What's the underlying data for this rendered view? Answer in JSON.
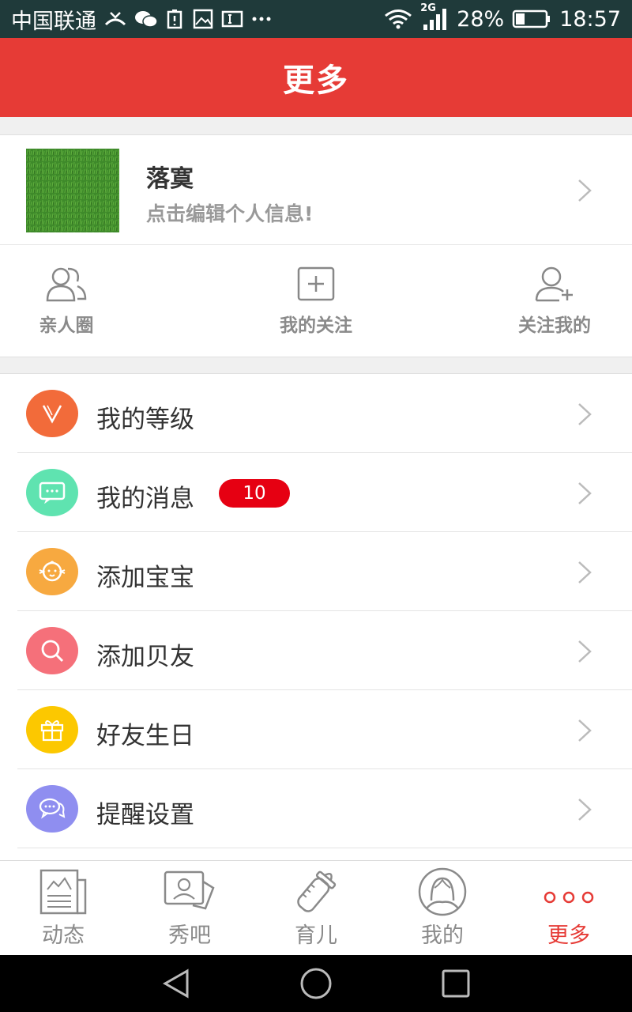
{
  "status_bar": {
    "carrier": "中国联通",
    "network": "2G",
    "battery": "28%",
    "time": "18:57",
    "icons": [
      "missed-call-icon",
      "wechat-icon",
      "battery-alert-icon",
      "image-icon",
      "sim-icon",
      "more-icon",
      "wifi-icon",
      "signal-icon",
      "battery-icon"
    ]
  },
  "header": {
    "title": "更多"
  },
  "profile": {
    "name": "落寞",
    "subtitle": "点击编辑个人信息!"
  },
  "shortcuts": [
    {
      "label": "亲人圈",
      "icon": "family-circle-icon"
    },
    {
      "label": "我的关注",
      "icon": "add-square-icon"
    },
    {
      "label": "关注我的",
      "icon": "add-user-icon"
    }
  ],
  "menu": [
    {
      "label": "我的等级",
      "icon": "level-v-icon",
      "color": "#f26b3a"
    },
    {
      "label": "我的消息",
      "icon": "message-icon",
      "color": "#5fe3b0",
      "badge": "10"
    },
    {
      "label": "添加宝宝",
      "icon": "baby-icon",
      "color": "#f7a940"
    },
    {
      "label": "添加贝友",
      "icon": "search-friend-icon",
      "color": "#f5707a"
    },
    {
      "label": "好友生日",
      "icon": "gift-icon",
      "color": "#fcc800"
    },
    {
      "label": "提醒设置",
      "icon": "chat-bubbles-icon",
      "color": "#8f8ef0"
    }
  ],
  "tabs": [
    {
      "label": "动态",
      "icon": "news-icon",
      "active": false
    },
    {
      "label": "秀吧",
      "icon": "portrait-icon",
      "active": false
    },
    {
      "label": "育儿",
      "icon": "baby-bottle-icon",
      "active": false
    },
    {
      "label": "我的",
      "icon": "user-circle-icon",
      "active": false
    },
    {
      "label": "更多",
      "icon": "more-dots-icon",
      "active": true
    }
  ],
  "colors": {
    "accent": "#e63b36",
    "badge": "#e60012",
    "tab_inactive": "#8a8a8a"
  }
}
